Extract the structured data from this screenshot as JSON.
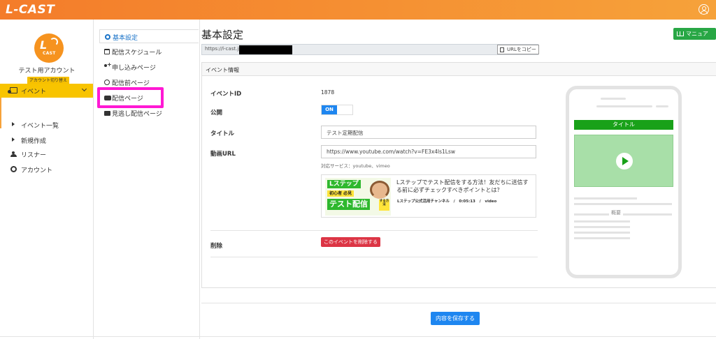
{
  "app": {
    "logo": "L-CAST"
  },
  "header": {
    "user_icon": "user-circle-icon"
  },
  "account": {
    "avatar_l": "L",
    "avatar_text": "CAST",
    "name": "テスト用アカウント",
    "switch_label": "アカウント切り替え"
  },
  "sidebar": {
    "event": {
      "label": "イベント",
      "icon": "event-icon"
    },
    "sub_items": [
      {
        "label": "イベント一覧"
      },
      {
        "label": "新規作成"
      }
    ],
    "listener": {
      "label": "リスナー",
      "icon": "users-icon"
    },
    "account": {
      "label": "アカウント",
      "icon": "gear-icon"
    }
  },
  "settings_menu": [
    {
      "label": "基本設定",
      "icon": "gear-icon",
      "active": true
    },
    {
      "label": "配信スケジュール",
      "icon": "calendar-icon"
    },
    {
      "label": "申し込みページ",
      "icon": "user-plus-icon"
    },
    {
      "label": "配信前ページ",
      "icon": "clock-icon"
    },
    {
      "label": "配信ページ",
      "icon": "youtube-icon",
      "highlighted": true
    },
    {
      "label": "見逃し配信ページ",
      "icon": "video-icon"
    }
  ],
  "main": {
    "title": "基本設定",
    "manual_button": "マニュアル",
    "url_prefix": "https://l-cast.jp",
    "copy_button": "URLをコピー",
    "card_header": "イベント情報",
    "fields": {
      "event_id_label": "イベントID",
      "event_id_value": "1878",
      "public_label": "公開",
      "public_toggle": "ON",
      "title_label": "タイトル",
      "title_value": "テスト定期配信",
      "video_url_label": "動画URL",
      "video_url_value": "https://www.youtube.com/watch?v=FE3x4ls1Lsw",
      "supported_services": "対応サービス：youtube、vimeo",
      "delete_label": "削除",
      "delete_button": "このイベントを削除する"
    },
    "preview": {
      "title": "Lステップでテスト配信をする方法！友だちに送信する前に必ずチェックすべきポイントとは？",
      "channel": "Lステップ公式活用チャンネル",
      "duration": "0:05:13",
      "type": "video",
      "thumb_line1": "Lステップ",
      "thumb_line2": "初心者 必見",
      "thumb_line3": "テスト配信",
      "thumb_line4": "する方法"
    },
    "phone": {
      "title": "タイトル",
      "overview": "概要"
    },
    "save_button": "内容を保存する"
  },
  "colors": {
    "header_start": "#f47c2a",
    "header_end": "#f6a23a",
    "active_nav": "#f8c400",
    "primary": "#1e86f0",
    "success": "#28a745",
    "danger": "#dc3545",
    "highlight": "#ff19d4"
  }
}
